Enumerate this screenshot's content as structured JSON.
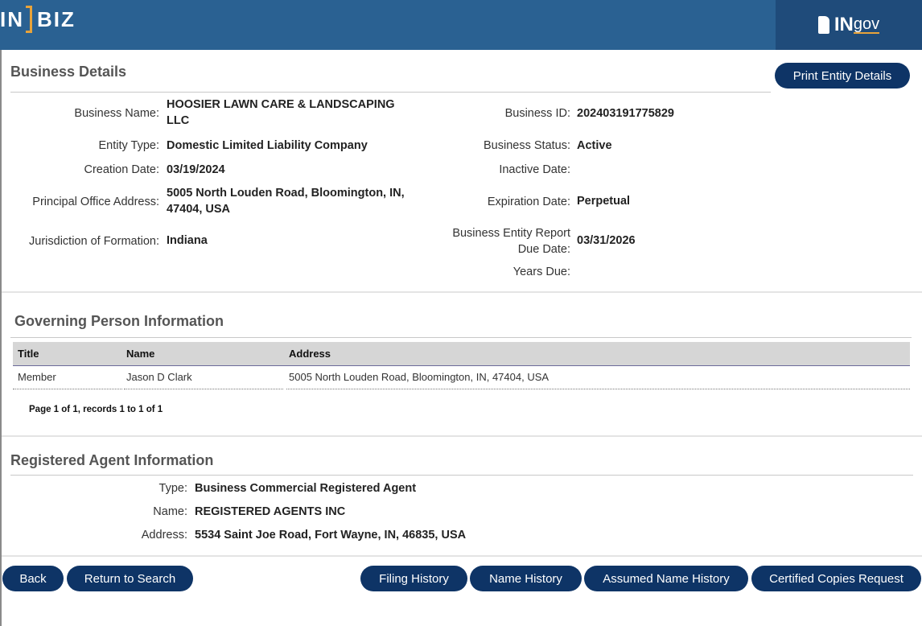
{
  "header": {
    "logo_left": "IN",
    "logo_right": "BIZ",
    "ingov_in": "IN",
    "ingov_gov": "gov"
  },
  "business_details": {
    "title": "Business Details",
    "print_button": "Print Entity Details",
    "left": [
      {
        "label": "Business Name:",
        "value": "HOOSIER LAWN CARE & LANDSCAPING LLC"
      },
      {
        "label": "Entity Type:",
        "value": "Domestic Limited Liability Company"
      },
      {
        "label": "Creation Date:",
        "value": "03/19/2024"
      },
      {
        "label": "Principal Office Address:",
        "value": "5005 North Louden Road, Bloomington, IN, 47404, USA"
      },
      {
        "label": "Jurisdiction of Formation:",
        "value": "Indiana"
      }
    ],
    "right": [
      {
        "label": "Business ID:",
        "value": "202403191775829"
      },
      {
        "label": "Business Status:",
        "value": "Active"
      },
      {
        "label": "Inactive Date:",
        "value": ""
      },
      {
        "label": "Expiration Date:",
        "value": "Perpetual"
      },
      {
        "label": "Business Entity Report Due Date:",
        "value": "03/31/2026"
      },
      {
        "label": "Years Due:",
        "value": ""
      }
    ]
  },
  "governing": {
    "title": "Governing Person Information",
    "columns": [
      "Title",
      "Name",
      "Address"
    ],
    "rows": [
      [
        "Member",
        "Jason D Clark",
        "5005 North Louden Road, Bloomington, IN, 47404, USA"
      ]
    ],
    "pager": "Page 1 of 1, records 1 to 1 of 1"
  },
  "agent": {
    "title": "Registered Agent Information",
    "fields": [
      {
        "label": "Type:",
        "value": "Business Commercial Registered Agent"
      },
      {
        "label": "Name:",
        "value": "REGISTERED AGENTS INC"
      },
      {
        "label": "Address:",
        "value": "5534 Saint Joe Road, Fort Wayne, IN, 46835, USA"
      }
    ]
  },
  "footer_buttons": {
    "back": "Back",
    "return": "Return to Search",
    "filing": "Filing History",
    "name_history": "Name History",
    "assumed": "Assumed Name History",
    "certified": "Certified Copies Request"
  },
  "colors": {
    "header": "#2a6192",
    "button": "#0e3466",
    "accent": "#e8a33a"
  }
}
